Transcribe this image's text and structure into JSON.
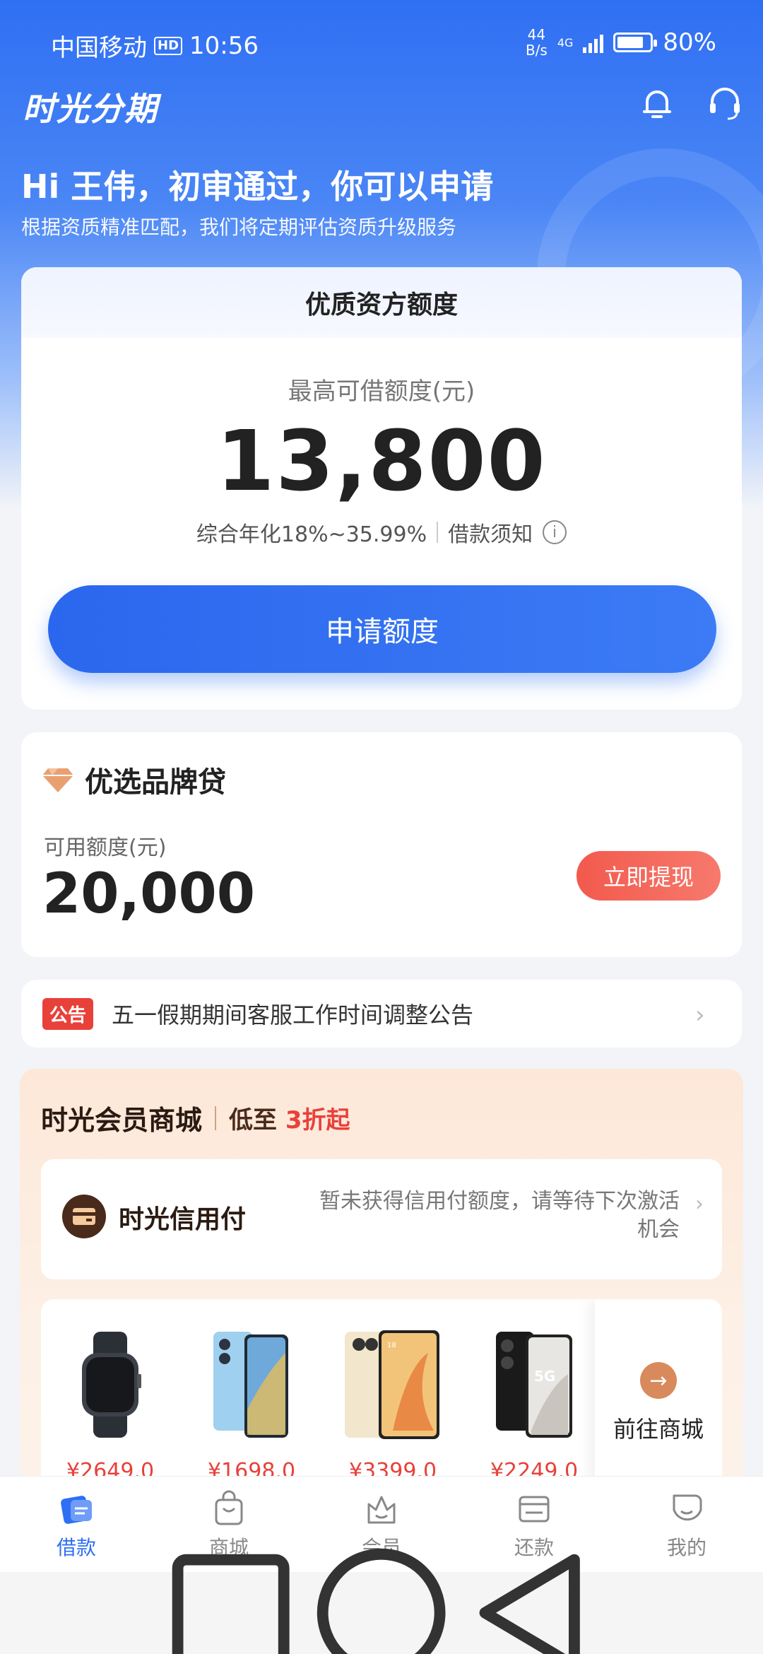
{
  "status_bar": {
    "carrier": "中国移动",
    "hd": "HD",
    "time": "10:56",
    "net_speed_value": "44",
    "net_speed_unit": "B/s",
    "network": "4G",
    "battery": "80%",
    "battery_level": 0.8
  },
  "header": {
    "app_title": "时光分期",
    "greeting": "Hi 王伟，初审通过，你可以申请",
    "subtitle": "根据资质精准匹配，我们将定期评估资质升级服务"
  },
  "quota_card": {
    "title": "优质资方额度",
    "label": "最高可借额度(元)",
    "amount": "13,800",
    "rate": "综合年化18%~35.99%",
    "notice_link": "借款须知",
    "apply_button": "申请额度"
  },
  "brand_loan": {
    "title": "优选品牌贷",
    "available_label": "可用额度(元)",
    "available_amount": "20,000",
    "withdraw_button": "立即提现"
  },
  "notice": {
    "tag": "公告",
    "text": "五一假期期间客服工作时间调整公告"
  },
  "mall": {
    "title": "时光会员商城",
    "promo_prefix": "低至",
    "promo_highlight": "3折起",
    "credit_pay_title": "时光信用付",
    "credit_pay_desc": "暂未获得信用付额度，请等待下次激活机会",
    "products": [
      {
        "icon": "smartwatch",
        "price": "¥2649.0"
      },
      {
        "icon": "blue-phone",
        "price": "¥1698.0"
      },
      {
        "icon": "gold-phone",
        "price": "¥3399.0"
      },
      {
        "icon": "black-5g-phone",
        "price": "¥2249.0"
      }
    ],
    "goto_label": "前往商城"
  },
  "tabs": [
    {
      "label": "借款",
      "icon": "loan-icon",
      "active": true
    },
    {
      "label": "商城",
      "icon": "shop-bag-icon",
      "active": false
    },
    {
      "label": "会员",
      "icon": "member-crown-icon",
      "active": false
    },
    {
      "label": "还款",
      "icon": "repay-card-icon",
      "active": false
    },
    {
      "label": "我的",
      "icon": "profile-icon",
      "active": false
    }
  ],
  "colors": {
    "primary": "#2f6ff3",
    "danger": "#e8413a",
    "mall_accent": "#d98a5c"
  }
}
